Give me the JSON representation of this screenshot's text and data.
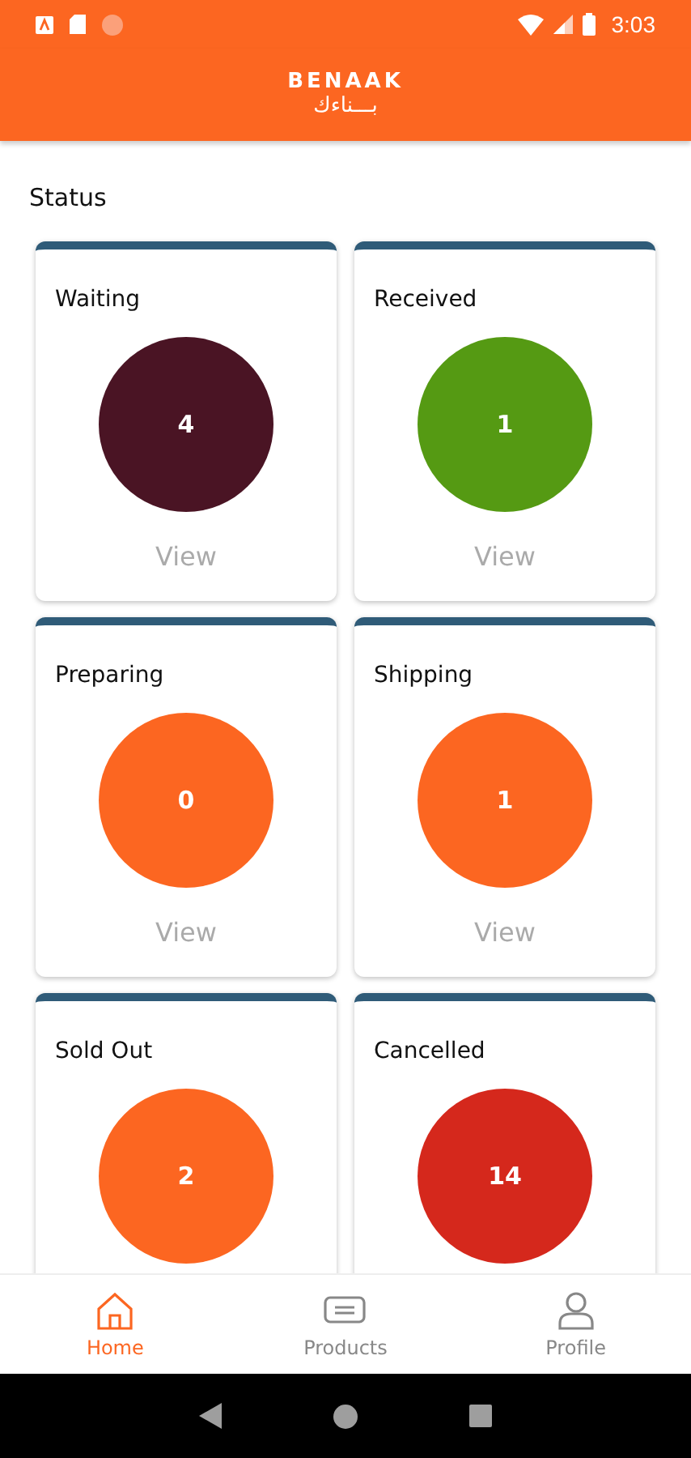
{
  "status_bar": {
    "time": "3:03"
  },
  "header": {
    "logo_latin": "BENAAK",
    "logo_arabic": "بـــناءك"
  },
  "section_title": "Status",
  "cards": [
    {
      "title": "Waiting",
      "count": "4",
      "color": "#4a1424",
      "action": "View"
    },
    {
      "title": "Received",
      "count": "1",
      "color": "#559a13",
      "action": "View"
    },
    {
      "title": "Preparing",
      "count": "0",
      "color": "#fc6621",
      "action": "View"
    },
    {
      "title": "Shipping",
      "count": "1",
      "color": "#fc6621",
      "action": "View"
    },
    {
      "title": "Sold Out",
      "count": "2",
      "color": "#fc6621"
    },
    {
      "title": "Cancelled",
      "count": "14",
      "color": "#d5281c"
    }
  ],
  "bottom_nav": [
    {
      "label": "Home",
      "kind": "home",
      "selected": true
    },
    {
      "label": "Products",
      "kind": "products",
      "selected": false
    },
    {
      "label": "Profile",
      "kind": "profile",
      "selected": false
    }
  ]
}
